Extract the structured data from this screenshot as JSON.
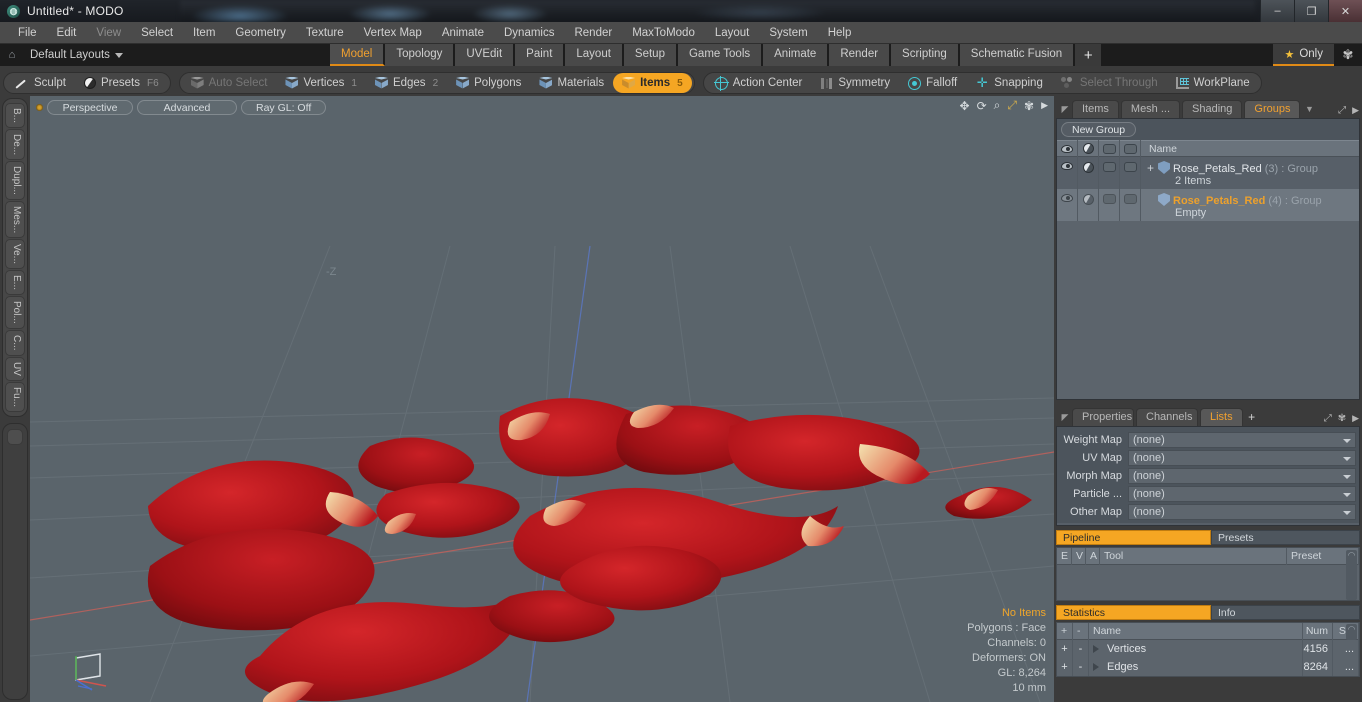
{
  "titlebar": {
    "title": "Untitled* - MODO",
    "app_icon": "modo-logo-icon",
    "minimize": "–",
    "restore": "❐",
    "close": "✕"
  },
  "menubar": {
    "items": [
      "File",
      "Edit",
      "View",
      "Select",
      "Item",
      "Geometry",
      "Texture",
      "Vertex Map",
      "Animate",
      "Dynamics",
      "Render",
      "MaxToModo",
      "Layout",
      "System",
      "Help"
    ]
  },
  "layoutbar": {
    "home_icon": "home-icon",
    "layout_selector": "Default Layouts",
    "tabs": [
      {
        "label": "Model",
        "active": true
      },
      {
        "label": "Topology",
        "active": false
      },
      {
        "label": "UVEdit",
        "active": false
      },
      {
        "label": "Paint",
        "active": false
      },
      {
        "label": "Layout",
        "active": false
      },
      {
        "label": "Setup",
        "active": false
      },
      {
        "label": "Game Tools",
        "active": false
      },
      {
        "label": "Animate",
        "active": false
      },
      {
        "label": "Render",
        "active": false
      },
      {
        "label": "Scripting",
        "active": false
      },
      {
        "label": "Schematic Fusion",
        "active": false
      }
    ],
    "add_tab": "+",
    "only_label": "Only",
    "only_icon": "star-icon",
    "gear_icon": "gear-icon"
  },
  "modebar": {
    "group_left": [
      {
        "label": "Sculpt",
        "icon": "brush-icon",
        "state": "normal",
        "num": ""
      },
      {
        "label": "Presets",
        "icon": "sphere-icon",
        "state": "normal",
        "num": "F6"
      }
    ],
    "group_mid": [
      {
        "label": "Auto Select",
        "icon": "cube-grey-icon",
        "state": "dim",
        "num": ""
      },
      {
        "label": "Vertices",
        "icon": "cube-blue-icon",
        "state": "normal",
        "num": "1"
      },
      {
        "label": "Edges",
        "icon": "cube-blue-icon",
        "state": "normal",
        "num": "2"
      },
      {
        "label": "Polygons",
        "icon": "cube-blue-icon",
        "state": "normal",
        "num": ""
      },
      {
        "label": "Materials",
        "icon": "cube-blue-icon",
        "state": "normal",
        "num": ""
      },
      {
        "label": "Items",
        "icon": "cube-amber-icon",
        "state": "active",
        "num": "5"
      }
    ],
    "group_right": [
      {
        "label": "Action Center",
        "icon": "target-icon",
        "state": "normal",
        "num": ""
      },
      {
        "label": "Symmetry",
        "icon": "symmetry-icon",
        "state": "normal",
        "num": ""
      },
      {
        "label": "Falloff",
        "icon": "falloff-icon",
        "state": "normal",
        "num": ""
      },
      {
        "label": "Snapping",
        "icon": "snap-icon",
        "state": "normal",
        "num": ""
      },
      {
        "label": "Select Through",
        "icon": "select-through-icon",
        "state": "dim",
        "num": ""
      },
      {
        "label": "WorkPlane",
        "icon": "workplane-icon",
        "state": "normal",
        "num": ""
      }
    ]
  },
  "vertical_tabs": [
    {
      "label": "B..."
    },
    {
      "label": "De..."
    },
    {
      "label": "Dupl..."
    },
    {
      "label": "Mes..."
    },
    {
      "label": "Ve..."
    },
    {
      "label": "E..."
    },
    {
      "label": "Pol..."
    },
    {
      "label": "C..."
    },
    {
      "label": "UV"
    },
    {
      "label": "Fu..."
    }
  ],
  "viewport": {
    "pills": [
      "Perspective",
      "Advanced",
      "Ray GL: Off"
    ],
    "indicator_icon": "active-view-dot-icon",
    "icons": [
      "pan-icon",
      "rotate-icon",
      "zoom-icon",
      "fit-view-icon",
      "view-gear-icon",
      "chevron-right-icon"
    ],
    "axis_label": "-Z",
    "gizmo": "axis-gizmo",
    "info": {
      "selection": "No Items",
      "polygons": "Polygons : Face",
      "channels": "Channels: 0",
      "deformers": "Deformers: ON",
      "gl": "GL: 8,264",
      "grid": "10 mm"
    },
    "background_color": "#5a646b",
    "petal_color": "#b2161c"
  },
  "groups_panel": {
    "tabs": [
      {
        "label": "Items",
        "active": false
      },
      {
        "label": "Mesh ...",
        "active": false
      },
      {
        "label": "Shading",
        "active": false
      },
      {
        "label": "Groups",
        "active": true
      }
    ],
    "overflow_icon": "chevron-down-icon",
    "expand_icon": "expand-panel-icon",
    "more_icon": "chevron-right-icon",
    "new_group_button": "New Group",
    "columns": [
      "visibility-eye-icon",
      "shading-ball-icon",
      "wireframe-icon",
      "selection-icon",
      "Name"
    ],
    "rows": [
      {
        "expander": "+",
        "name": "Rose_Petals_Red",
        "index": "(3)",
        "kind": ": Group",
        "detail": "2 Items",
        "selected": false
      },
      {
        "expander": "",
        "name": "Rose_Petals_Red",
        "index": "(4)",
        "kind": ": Group",
        "detail": "Empty",
        "selected": true
      }
    ]
  },
  "lists_panel": {
    "tabs": [
      {
        "label": "Properties",
        "active": false
      },
      {
        "label": "Channels",
        "active": false
      },
      {
        "label": "Lists",
        "active": true
      }
    ],
    "add_tab": "+",
    "expand_icon": "expand-panel-icon",
    "gear_icon": "gear-icon",
    "more_icon": "chevron-right-icon",
    "fields": [
      {
        "label": "Weight Map",
        "value": "(none)"
      },
      {
        "label": "UV Map",
        "value": "(none)"
      },
      {
        "label": "Morph Map",
        "value": "(none)"
      },
      {
        "label": "Particle   ...",
        "value": "(none)"
      },
      {
        "label": "Other Map",
        "value": "(none)"
      }
    ]
  },
  "pipeline_panel": {
    "segments": [
      {
        "label": "Pipeline",
        "active": true
      },
      {
        "label": "Presets",
        "active": false
      }
    ],
    "columns": [
      "E",
      "V",
      "A",
      "Tool",
      "Preset"
    ],
    "rows": []
  },
  "statistics_panel": {
    "segments": [
      {
        "label": "Statistics",
        "active": true
      },
      {
        "label": "Info",
        "active": false
      }
    ],
    "columns": [
      "+",
      "-",
      "Name",
      "Num",
      "Sel"
    ],
    "rows": [
      {
        "add": "+",
        "sub": "-",
        "expander": "triangle-right-icon",
        "name": "Vertices",
        "num": "4156",
        "sel": "..."
      },
      {
        "add": "+",
        "sub": "-",
        "expander": "triangle-right-icon",
        "name": "Edges",
        "num": "8264",
        "sel": "..."
      }
    ]
  },
  "colors": {
    "accent": "#f5a623",
    "panel_bg": "#3b3b3b",
    "tree_bg": "#575f68",
    "viewport_bg": "#5a646b",
    "amber_text": "#eda12c"
  }
}
